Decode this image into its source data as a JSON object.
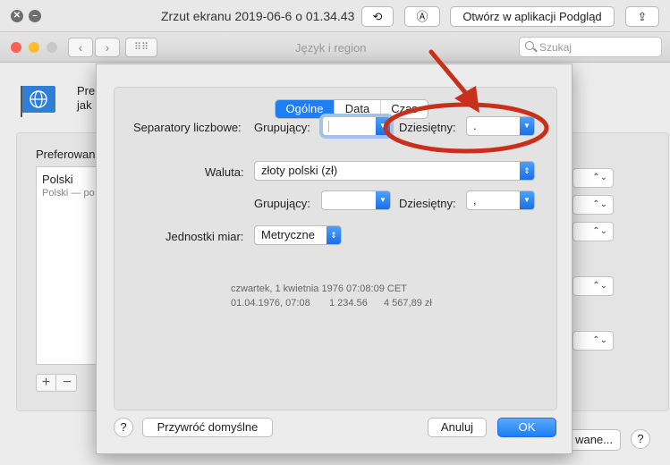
{
  "outer_window": {
    "title": "Zrzut ekranu 2019-06-6 o 01.34.43",
    "open_in_preview_label": "Otwórz w aplikacji Podgląd"
  },
  "prefs_window": {
    "title": "Język i region",
    "search_placeholder": "Szukaj",
    "intro_line1": "Pre",
    "intro_line2": "jak",
    "preferred_label": "Preferowan",
    "languages": [
      {
        "name": "Polski",
        "sub": "Polski — po"
      }
    ],
    "advanced_button_label": "wane...",
    "help_label": "?"
  },
  "sheet": {
    "tabs": [
      {
        "label": "Ogólne",
        "active": true
      },
      {
        "label": "Data",
        "active": false
      },
      {
        "label": "Czas",
        "active": false
      }
    ],
    "number_separators": {
      "label": "Separatory liczbowe:",
      "grouping_label": "Grupujący:",
      "grouping_value": "",
      "decimal_label": "Dziesiętny:",
      "decimal_value": "."
    },
    "currency": {
      "label": "Waluta:",
      "value": "złoty polski (zł)",
      "grouping_label": "Grupujący:",
      "grouping_value": "",
      "decimal_label": "Dziesiętny:",
      "decimal_value": ","
    },
    "units": {
      "label": "Jednostki miar:",
      "value": "Metryczne"
    },
    "samples": {
      "line1": "czwartek, 1 kwietnia 1976 07:08:09 CET",
      "line2_date": "01.04.1976, 07:08",
      "line2_number": "1 234.56",
      "line2_currency": "4 567,89 zł"
    },
    "help_label": "?",
    "restore_label": "Przywróć domyślne",
    "cancel_label": "Anuluj",
    "ok_label": "OK"
  },
  "colors": {
    "accent": "#1d7ff2",
    "annotation": "#c9301c"
  },
  "icons": [
    "close-icon",
    "share-icon",
    "markup-icon",
    "rotate-icon",
    "globe-flag-icon",
    "grid-icon",
    "search-icon"
  ]
}
